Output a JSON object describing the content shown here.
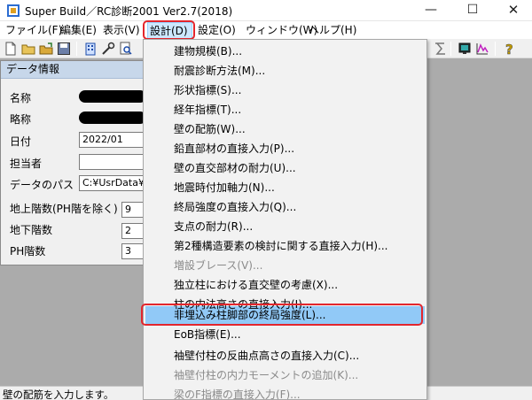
{
  "window": {
    "title": "Super Build／RC診断2001 Ver2.7(2018)",
    "minimize_glyph": "—",
    "maximize_glyph": "☐",
    "close_glyph": "✕"
  },
  "menubar": {
    "items": [
      {
        "label": "ファイル(F)"
      },
      {
        "label": "編集(E)"
      },
      {
        "label": "表示(V)"
      },
      {
        "label": "設計(D)"
      },
      {
        "label": "設定(O)"
      },
      {
        "label": "ウィンドウ(W)"
      },
      {
        "label": "ヘルプ(H)"
      }
    ],
    "active_index": 3
  },
  "toolbar": {
    "icons": [
      "new-file-icon",
      "open-folder-icon",
      "folder-icon",
      "save-icon",
      "building-icon",
      "tools-icon",
      "search-icon",
      "sigma-icon",
      "monitor-icon",
      "graph-icon",
      "help-icon"
    ]
  },
  "data_panel": {
    "title": "データ情報",
    "fields": [
      {
        "label": "名称",
        "value": ""
      },
      {
        "label": "略称",
        "value": ""
      },
      {
        "label": "日付",
        "value": "2022/01"
      },
      {
        "label": "担当者",
        "value": ""
      },
      {
        "label": "データのパス",
        "value": "C:¥UsrData¥S"
      },
      {
        "label": "地上階数(PH階を除く)",
        "value": "9"
      },
      {
        "label": "地下階数",
        "value": "2"
      },
      {
        "label": "PH階数",
        "value": "3"
      }
    ]
  },
  "design_menu": {
    "items": [
      {
        "label": "建物規模(B)...",
        "enabled": true
      },
      {
        "label": "耐震診断方法(M)...",
        "enabled": true
      },
      {
        "label": "形状指標(S)...",
        "enabled": true
      },
      {
        "label": "経年指標(T)...",
        "enabled": true
      },
      {
        "label": "壁の配筋(W)...",
        "enabled": true
      },
      {
        "label": "鉛直部材の直接入力(P)...",
        "enabled": true
      },
      {
        "label": "壁の直交部材の耐力(U)...",
        "enabled": true
      },
      {
        "label": "地震時付加軸力(N)...",
        "enabled": true
      },
      {
        "label": "終局強度の直接入力(Q)...",
        "enabled": true
      },
      {
        "label": "支点の耐力(R)...",
        "enabled": true
      },
      {
        "label": "第2種構造要素の検討に関する直接入力(H)...",
        "enabled": true
      },
      {
        "label": "増設ブレース(V)...",
        "enabled": false
      },
      {
        "label": "独立柱における直交壁の考慮(X)...",
        "enabled": true
      },
      {
        "label": "柱の内法高さの直接入力(I)...",
        "enabled": true
      },
      {
        "label": "非埋込み柱脚部の終局強度(L)...",
        "enabled": true
      },
      {
        "label": "EoB指標(E)...",
        "enabled": true
      },
      {
        "label": "袖壁付柱の反曲点高さの直接入力(C)...",
        "enabled": true
      },
      {
        "label": "袖壁付柱の内力モーメントの追加(K)...",
        "enabled": false
      },
      {
        "label": "梁のF指標の直接入力(F)...",
        "enabled": false
      }
    ],
    "highlighted_index": 14
  },
  "statusbar": {
    "text": "壁の配筋を入力します。"
  },
  "colors": {
    "highlight": "#91c9f7",
    "callout": "#e3262d",
    "menu_active": "#cce8ff",
    "mdi_background": "#ababab",
    "panel_title": "#c7d7ea"
  }
}
